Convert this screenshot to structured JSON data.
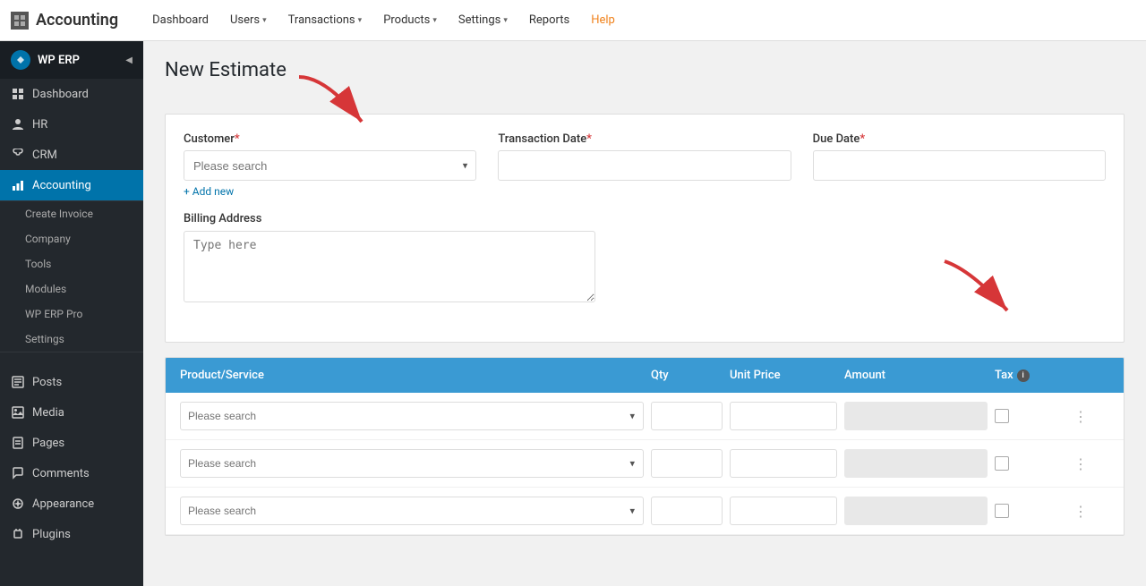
{
  "topbar": {
    "module_icon": "grid-icon",
    "title": "Accounting",
    "nav": [
      {
        "label": "Dashboard",
        "has_dropdown": false
      },
      {
        "label": "Users",
        "has_dropdown": true
      },
      {
        "label": "Transactions",
        "has_dropdown": true
      },
      {
        "label": "Products",
        "has_dropdown": true
      },
      {
        "label": "Settings",
        "has_dropdown": true
      },
      {
        "label": "Reports",
        "has_dropdown": false
      },
      {
        "label": "Help",
        "has_dropdown": false,
        "class": "help"
      }
    ]
  },
  "sidebar": {
    "wp_erp_label": "WP ERP",
    "items": [
      {
        "label": "Dashboard",
        "icon": "⊞",
        "active": false
      },
      {
        "label": "HR",
        "icon": "👤",
        "active": false
      },
      {
        "label": "CRM",
        "icon": "☎",
        "active": false
      },
      {
        "label": "Accounting",
        "icon": "📊",
        "active": true
      },
      {
        "label": "Create Invoice",
        "icon": "",
        "active": false,
        "sub": true
      },
      {
        "label": "Company",
        "icon": "",
        "active": false,
        "sub": true
      },
      {
        "label": "Tools",
        "icon": "",
        "active": false,
        "sub": true
      },
      {
        "label": "Modules",
        "icon": "",
        "active": false,
        "sub": true
      },
      {
        "label": "WP ERP Pro",
        "icon": "",
        "active": false,
        "sub": true
      },
      {
        "label": "Settings",
        "icon": "",
        "active": false,
        "sub": true
      }
    ],
    "bottom_items": [
      {
        "label": "Posts",
        "icon": "📝"
      },
      {
        "label": "Media",
        "icon": "🎞"
      },
      {
        "label": "Pages",
        "icon": "📄"
      },
      {
        "label": "Comments",
        "icon": "💬"
      },
      {
        "label": "Appearance",
        "icon": "🎨"
      },
      {
        "label": "Plugins",
        "icon": "🔌"
      }
    ]
  },
  "page": {
    "title": "New Estimate",
    "form": {
      "customer_label": "Customer",
      "customer_placeholder": "Please search",
      "transaction_date_label": "Transaction Date",
      "due_date_label": "Due Date",
      "add_new_label": "+ Add new",
      "billing_address_label": "Billing Address",
      "billing_placeholder": "Type here"
    },
    "table": {
      "headers": [
        "Product/Service",
        "Qty",
        "Unit Price",
        "Amount",
        "Tax"
      ],
      "rows": [
        {
          "product_placeholder": "Please search",
          "qty": "",
          "unit_price": "",
          "amount": ""
        },
        {
          "product_placeholder": "Please search",
          "qty": "",
          "unit_price": "",
          "amount": ""
        },
        {
          "product_placeholder": "Please search",
          "qty": "",
          "unit_price": "",
          "amount": ""
        }
      ]
    }
  }
}
